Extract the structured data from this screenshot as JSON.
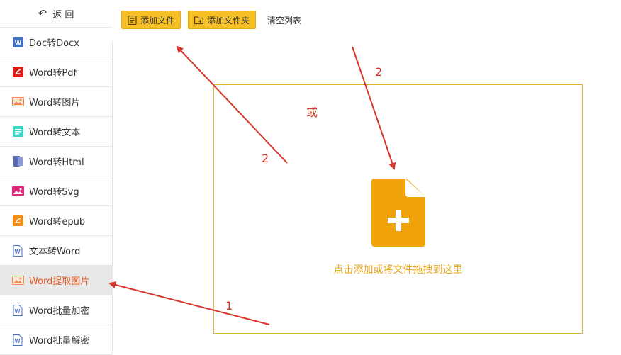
{
  "sidebar": {
    "back_label": "返 回",
    "items": [
      {
        "label": "Doc转Docx",
        "icon": "word-doc-icon"
      },
      {
        "label": "Word转Pdf",
        "icon": "pdf-icon"
      },
      {
        "label": "Word转图片",
        "icon": "image-icon"
      },
      {
        "label": "Word转文本",
        "icon": "text-icon"
      },
      {
        "label": "Word转Html",
        "icon": "html-icon"
      },
      {
        "label": "Word转Svg",
        "icon": "svg-icon"
      },
      {
        "label": "Word转epub",
        "icon": "epub-icon"
      },
      {
        "label": "文本转Word",
        "icon": "word-doc-icon"
      },
      {
        "label": "Word提取图片",
        "icon": "image-icon",
        "active": true
      },
      {
        "label": "Word批量加密",
        "icon": "word-doc-icon"
      },
      {
        "label": "Word批量解密",
        "icon": "word-doc-icon"
      }
    ]
  },
  "toolbar": {
    "add_file_label": "添加文件",
    "add_folder_label": "添加文件夹",
    "clear_list_label": "清空列表"
  },
  "drop_zone": {
    "hint": "点击添加或将文件拖拽到这里"
  },
  "annotations": {
    "or_label": "或",
    "step1": "1",
    "step2a": "2",
    "step2b": "2"
  },
  "colors": {
    "accent": "#f6bf26",
    "active_text": "#e4571f",
    "annotation_red": "#d9362a",
    "drop_border": "#e2b230"
  }
}
